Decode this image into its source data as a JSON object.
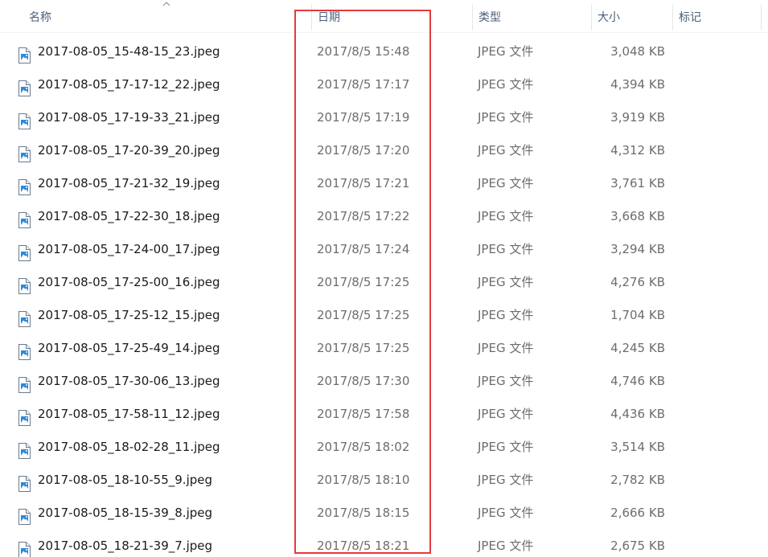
{
  "columns": {
    "name": "名称",
    "date": "日期",
    "type": "类型",
    "size": "大小",
    "tags": "标记"
  },
  "sort_indicator": "chevron-up-icon",
  "highlight_color": "#e5393e",
  "files": [
    {
      "name": "2017-08-05_15-48-15_23.jpeg",
      "date": "2017/8/5 15:48",
      "type": "JPEG 文件",
      "size": "3,048 KB"
    },
    {
      "name": "2017-08-05_17-17-12_22.jpeg",
      "date": "2017/8/5 17:17",
      "type": "JPEG 文件",
      "size": "4,394 KB"
    },
    {
      "name": "2017-08-05_17-19-33_21.jpeg",
      "date": "2017/8/5 17:19",
      "type": "JPEG 文件",
      "size": "3,919 KB"
    },
    {
      "name": "2017-08-05_17-20-39_20.jpeg",
      "date": "2017/8/5 17:20",
      "type": "JPEG 文件",
      "size": "4,312 KB"
    },
    {
      "name": "2017-08-05_17-21-32_19.jpeg",
      "date": "2017/8/5 17:21",
      "type": "JPEG 文件",
      "size": "3,761 KB"
    },
    {
      "name": "2017-08-05_17-22-30_18.jpeg",
      "date": "2017/8/5 17:22",
      "type": "JPEG 文件",
      "size": "3,668 KB"
    },
    {
      "name": "2017-08-05_17-24-00_17.jpeg",
      "date": "2017/8/5 17:24",
      "type": "JPEG 文件",
      "size": "3,294 KB"
    },
    {
      "name": "2017-08-05_17-25-00_16.jpeg",
      "date": "2017/8/5 17:25",
      "type": "JPEG 文件",
      "size": "4,276 KB"
    },
    {
      "name": "2017-08-05_17-25-12_15.jpeg",
      "date": "2017/8/5 17:25",
      "type": "JPEG 文件",
      "size": "1,704 KB"
    },
    {
      "name": "2017-08-05_17-25-49_14.jpeg",
      "date": "2017/8/5 17:25",
      "type": "JPEG 文件",
      "size": "4,245 KB"
    },
    {
      "name": "2017-08-05_17-30-06_13.jpeg",
      "date": "2017/8/5 17:30",
      "type": "JPEG 文件",
      "size": "4,746 KB"
    },
    {
      "name": "2017-08-05_17-58-11_12.jpeg",
      "date": "2017/8/5 17:58",
      "type": "JPEG 文件",
      "size": "4,436 KB"
    },
    {
      "name": "2017-08-05_18-02-28_11.jpeg",
      "date": "2017/8/5 18:02",
      "type": "JPEG 文件",
      "size": "3,514 KB"
    },
    {
      "name": "2017-08-05_18-10-55_9.jpeg",
      "date": "2017/8/5 18:10",
      "type": "JPEG 文件",
      "size": "2,782 KB"
    },
    {
      "name": "2017-08-05_18-15-39_8.jpeg",
      "date": "2017/8/5 18:15",
      "type": "JPEG 文件",
      "size": "2,666 KB"
    },
    {
      "name": "2017-08-05_18-21-39_7.jpeg",
      "date": "2017/8/5 18:21",
      "type": "JPEG 文件",
      "size": "2,675 KB"
    }
  ]
}
